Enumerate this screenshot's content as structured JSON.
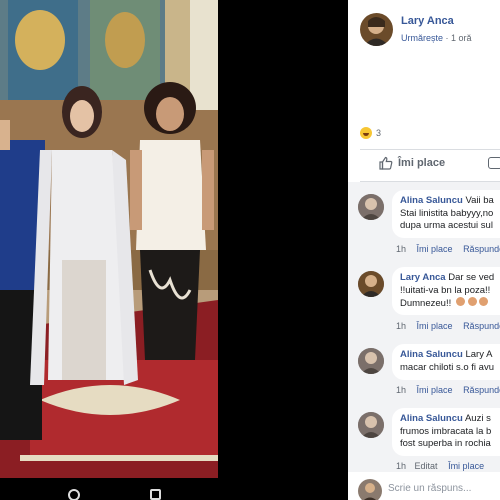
{
  "post": {
    "author": "Lary Anca",
    "follow_label": "Urmărește",
    "separator": "·",
    "timestamp": "1 oră",
    "reaction_count": "3",
    "like_label": "Îmi place"
  },
  "comments": [
    {
      "author": "Alina Saluncu",
      "lines": [
        "Vaii ba",
        "Stai linistita babyyy,no",
        "dupa urma acestui sul"
      ],
      "time": "1h",
      "like": "Îmi place",
      "reply": "Răspunde"
    },
    {
      "author": "Lary Anca",
      "lines": [
        "Dar se ved",
        "!!uitati-va bn la poza!!",
        "Dumnezeu!!"
      ],
      "time": "1h",
      "like": "Îmi place",
      "reply": "Răspunde"
    },
    {
      "author": "Alina Saluncu",
      "lines": [
        "Lary A",
        "macar chiloti s.o fi avu"
      ],
      "time": "1h",
      "like": "Îmi place",
      "reply": "Răspunde"
    },
    {
      "author": "Alina Saluncu",
      "lines": [
        "Auzi s",
        "frumos imbracata la b",
        "fost superba in rochia"
      ],
      "time": "1h",
      "edited": "Editat",
      "like": "Îmi place"
    }
  ],
  "reply_placeholder": "Scrie un răspuns..."
}
